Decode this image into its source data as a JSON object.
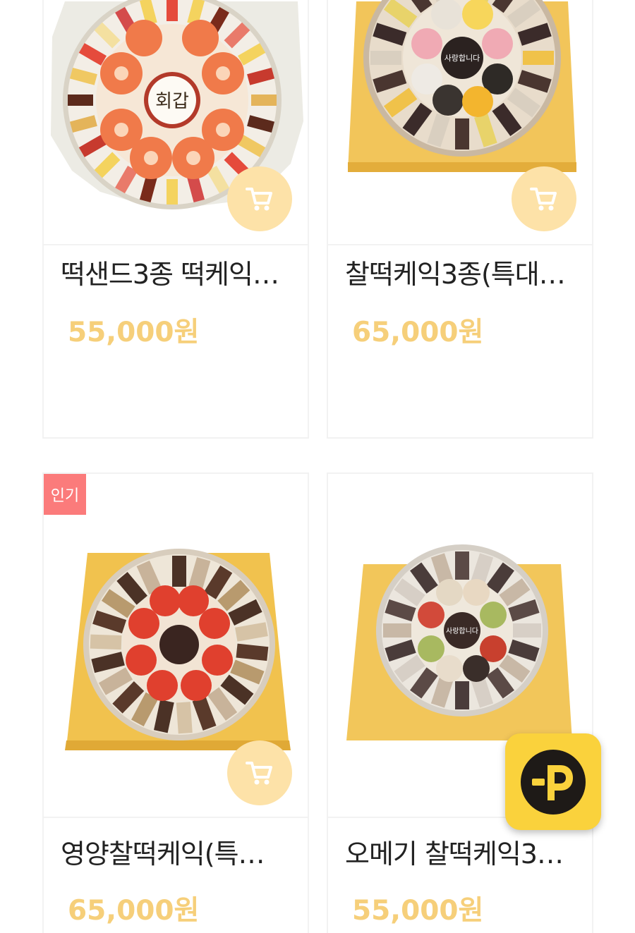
{
  "products": [
    {
      "name": "떡샌드3종 떡케익…",
      "price": "55,000원",
      "badge": "",
      "cake_label": "회갑",
      "image_icon": "cake-photo-icon"
    },
    {
      "name": "찰떡케익3종(특대…",
      "price": "65,000원",
      "badge": "",
      "cake_label": "사랑합니다",
      "image_icon": "cake-photo-icon"
    },
    {
      "name": "영양찰떡케익(특…",
      "price": "65,000원",
      "badge": "인기",
      "cake_label": "",
      "image_icon": "cake-photo-icon"
    },
    {
      "name": "오메기 찰떡케익3…",
      "price": "55,000원",
      "badge": "",
      "cake_label": "사랑합니다",
      "image_icon": "cake-photo-icon"
    }
  ],
  "cart_icon": "cart-icon",
  "floating_button": {
    "icon": "p-point-icon"
  },
  "colors": {
    "price": "#f6cf7a",
    "cart_button": "#fde2a8",
    "badge": "#fb7b7b",
    "fab": "#fad23c"
  }
}
